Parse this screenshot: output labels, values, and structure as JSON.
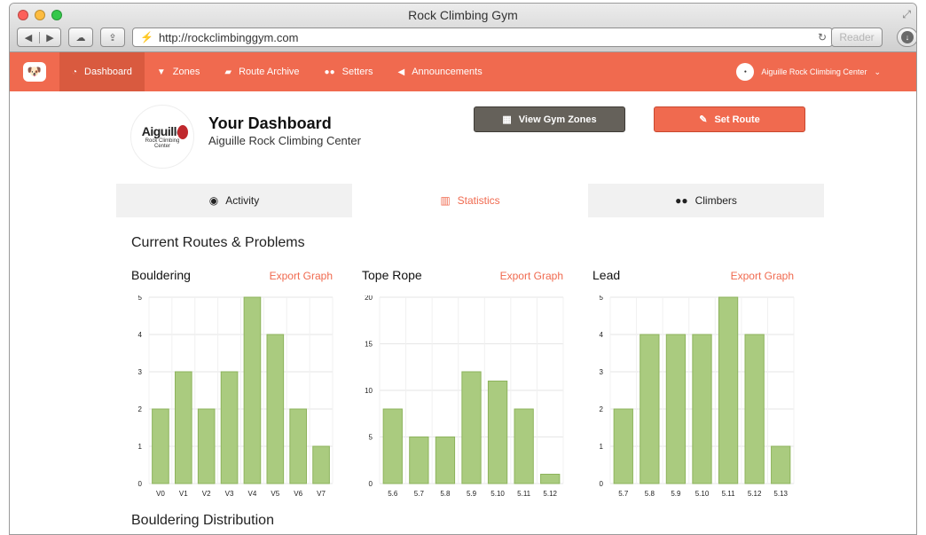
{
  "window": {
    "title": "Rock Climbing Gym"
  },
  "browser": {
    "url": "http://rockclimbinggym.com",
    "reader_label": "Reader"
  },
  "nav": {
    "items": [
      {
        "label": "Dashboard",
        "icon": "dashboard-icon",
        "active": true
      },
      {
        "label": "Zones",
        "icon": "zones-icon",
        "active": false
      },
      {
        "label": "Route Archive",
        "icon": "archive-icon",
        "active": false
      },
      {
        "label": "Setters",
        "icon": "setters-icon",
        "active": false
      },
      {
        "label": "Announcements",
        "icon": "megaphone-icon",
        "active": false
      }
    ],
    "user_label": "Aiguille Rock Climbing Center"
  },
  "header": {
    "logo_brand": "Aiguille",
    "logo_sub_1": "Rock Climbing",
    "logo_sub_2": "Center",
    "title": "Your Dashboard",
    "subtitle": "Aiguille Rock Climbing Center",
    "view_zones_label": "View Gym Zones",
    "set_route_label": "Set Route"
  },
  "tabs": [
    {
      "label": "Activity",
      "active": false
    },
    {
      "label": "Statistics",
      "active": true
    },
    {
      "label": "Climbers",
      "active": false
    }
  ],
  "section_title": "Current Routes & Problems",
  "export_label": "Export Graph",
  "next_section_title": "Bouldering Distribution",
  "colors": {
    "accent": "#f06a4f",
    "bar_fill": "#aacb7f",
    "bar_stroke": "#8db35c"
  },
  "chart_data": [
    {
      "type": "bar",
      "title": "Bouldering",
      "categories": [
        "V0",
        "V1",
        "V2",
        "V3",
        "V4",
        "V5",
        "V6",
        "V7"
      ],
      "values": [
        2,
        3,
        2,
        3,
        5,
        4,
        2,
        1
      ],
      "ylim": [
        0,
        5
      ],
      "yticks": [
        0,
        1,
        2,
        3,
        4,
        5
      ],
      "grid": true
    },
    {
      "type": "bar",
      "title": "Tope Rope",
      "categories": [
        "5.6",
        "5.7",
        "5.8",
        "5.9",
        "5.10",
        "5.11",
        "5.12"
      ],
      "values": [
        8,
        5,
        5,
        12,
        11,
        8,
        1
      ],
      "ylim": [
        0,
        20
      ],
      "yticks": [
        0,
        5,
        10,
        15,
        20
      ],
      "grid": true
    },
    {
      "type": "bar",
      "title": "Lead",
      "categories": [
        "5.7",
        "5.8",
        "5.9",
        "5.10",
        "5.11",
        "5.12",
        "5.13"
      ],
      "values": [
        2,
        4,
        4,
        4,
        5,
        4,
        1
      ],
      "ylim": [
        0,
        5
      ],
      "yticks": [
        0,
        1,
        2,
        3,
        4,
        5
      ],
      "grid": true
    }
  ]
}
